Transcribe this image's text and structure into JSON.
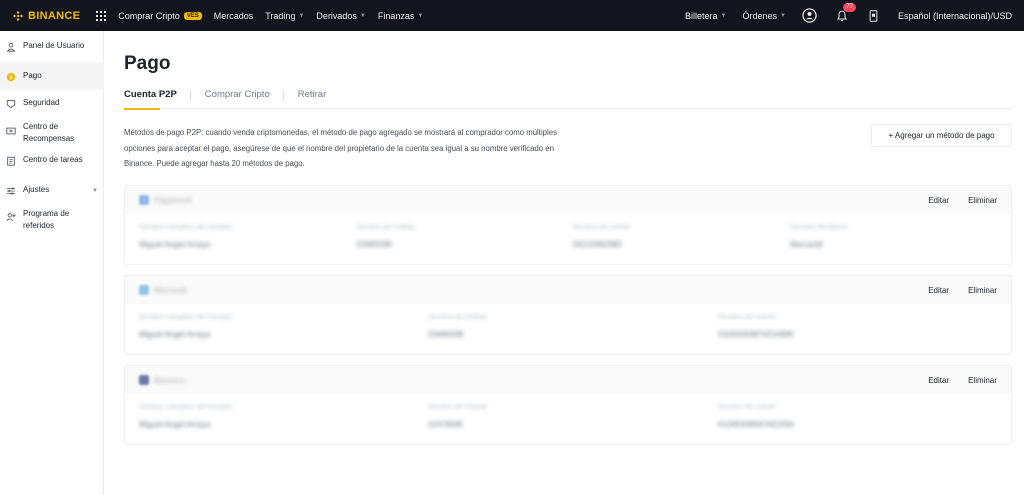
{
  "brand": {
    "name": "BINANCE",
    "color": "#f0b90b"
  },
  "nav": {
    "buy_crypto": "Comprar Cripto",
    "buy_crypto_badge": "VES",
    "markets": "Mercados",
    "trading": "Trading",
    "derivatives": "Derivados",
    "finance": "Finanzas",
    "wallet": "Billetera",
    "orders": "Órdenes",
    "notification_count": "77",
    "language": "Español (Internacional)/USD"
  },
  "sidebar": {
    "items": [
      {
        "label": "Panel de Usuario",
        "icon": "user-icon"
      },
      {
        "label": "Pago",
        "icon": "payment-icon"
      },
      {
        "label": "Seguridad",
        "icon": "shield-icon"
      },
      {
        "label": "Centro de Recompensas",
        "icon": "ticket-icon"
      },
      {
        "label": "Centro de tareas",
        "icon": "clipboard-icon"
      },
      {
        "label": "Ajustes",
        "icon": "sliders-icon"
      },
      {
        "label": "Programa de referidos",
        "icon": "add-user-icon"
      }
    ]
  },
  "page": {
    "title": "Pago",
    "tabs": [
      "Cuenta P2P",
      "Comprar Cripto",
      "Retirar"
    ],
    "description": "Métodos de pago P2P: cuando venda criptomonedas, el método de pago agregado se mostrará al comprador como múltiples opciones para aceptar el pago, asegúrese de que el nombre del propietario de la cuenta sea igual a su nombre verificado en Binance. Puede agregar hasta 20 métodos de pago.",
    "add_button": "+ Agregar un método de pago",
    "edit_label": "Editar",
    "delete_label": "Eliminar"
  },
  "payment_methods": [
    {
      "logo_color": "#8fb4e8",
      "name": "Pagomovil",
      "fields": [
        {
          "label": "Nombre completo del receptor",
          "value": "Miguel Angel Arraya"
        },
        {
          "label": "Numero de Cédula",
          "value": "23485599"
        },
        {
          "label": "Numero de celular",
          "value": "04123482980"
        },
        {
          "label": "Nombre del Banco",
          "value": "Mercantil"
        }
      ]
    },
    {
      "logo_color": "#8fc7e8",
      "name": "Mercantil",
      "fields": [
        {
          "label": "Nombre completo del receptor",
          "value": "Miguel Angel Arraya"
        },
        {
          "label": "Numero de Cédula",
          "value": "23485599"
        },
        {
          "label": "Número de cuenta",
          "value": "01050263874210685"
        }
      ]
    },
    {
      "logo_color": "#6a78a8",
      "name": "Banesco",
      "fields": [
        {
          "label": "Nombre completo del receptor",
          "value": "Miguel Angel Arraya"
        },
        {
          "label": "Numero de Cédula",
          "value": "11479595"
        },
        {
          "label": "Número de cuenta",
          "value": "01340349947422256"
        }
      ]
    }
  ]
}
